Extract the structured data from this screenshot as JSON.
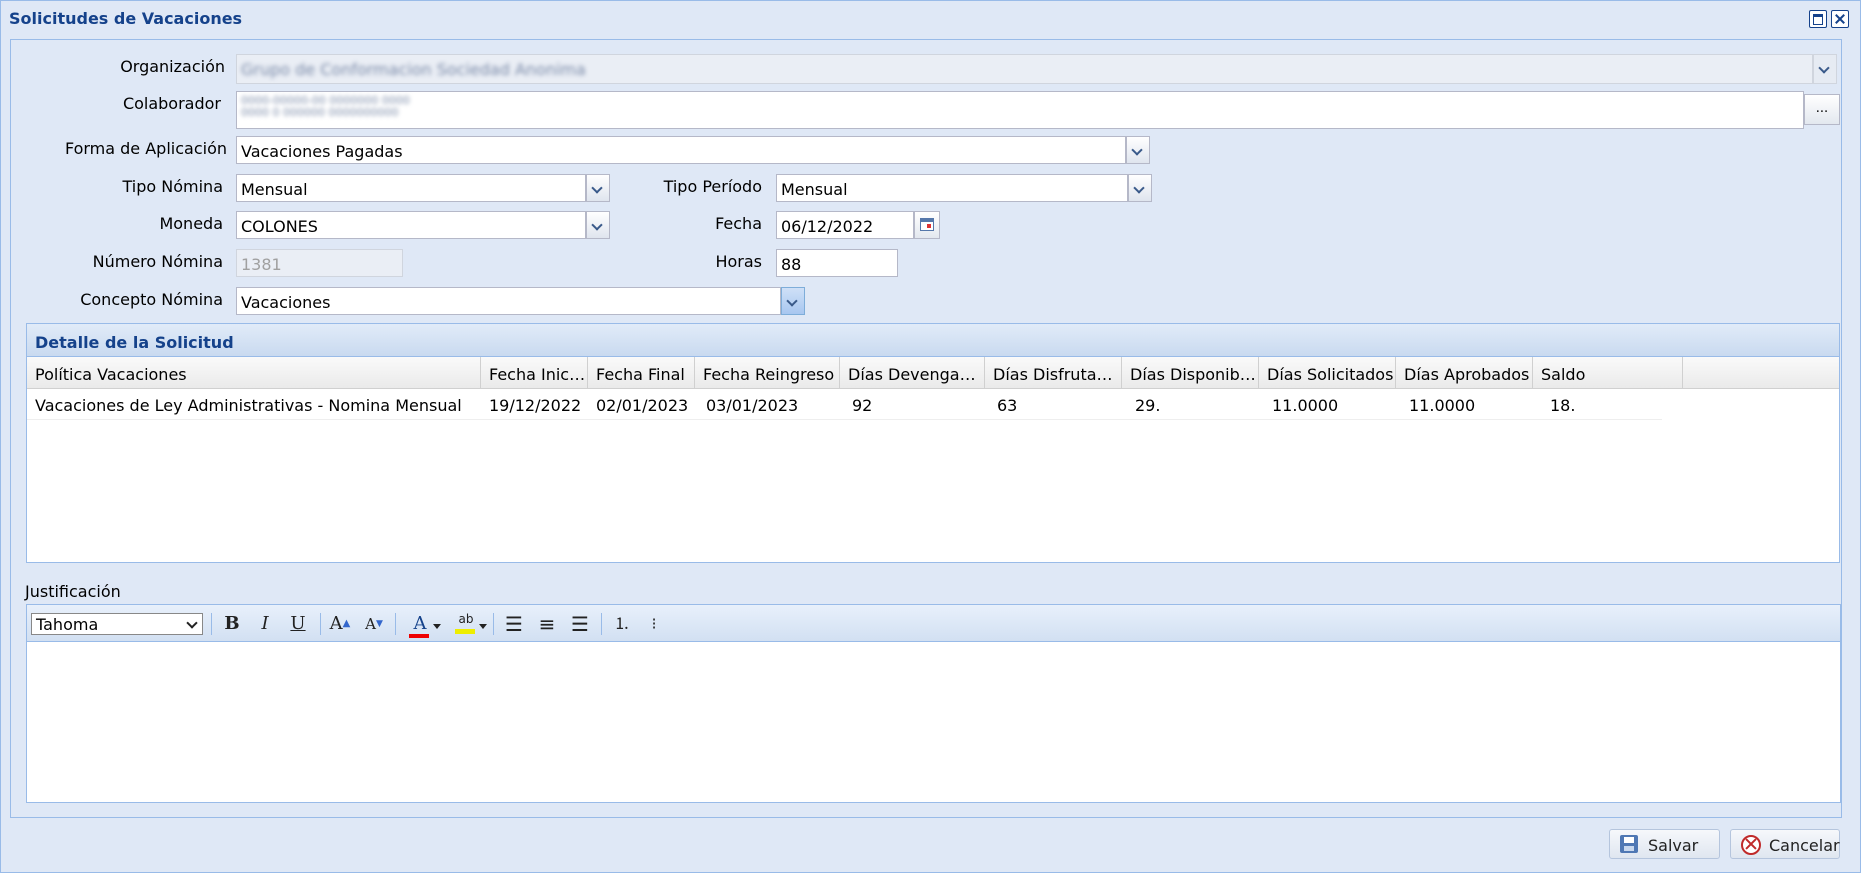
{
  "window": {
    "title": "Solicitudes de Vacaciones"
  },
  "form": {
    "organizacion": {
      "label": "Organización",
      "value": "Grupo de Conformacion Sociedad Anonima"
    },
    "colaborador": {
      "label": "Colaborador",
      "value_line1": "0000-00000-00 0000000 0000",
      "value_line2": "0000 0 000000 0000000000",
      "button": "..."
    },
    "forma_aplicacion": {
      "label": "Forma de Aplicación",
      "value": "Vacaciones Pagadas"
    },
    "tipo_nomina": {
      "label": "Tipo Nómina",
      "value": "Mensual"
    },
    "tipo_periodo": {
      "label": "Tipo Período",
      "value": "Mensual"
    },
    "moneda": {
      "label": "Moneda",
      "value": "COLONES"
    },
    "fecha": {
      "label": "Fecha",
      "value": "06/12/2022"
    },
    "numero_nomina": {
      "label": "Número Nómina",
      "value": "1381"
    },
    "horas": {
      "label": "Horas",
      "value": "88"
    },
    "concepto_nomina": {
      "label": "Concepto Nómina",
      "value": "Vacaciones"
    }
  },
  "detalle": {
    "title": "Detalle de la Solicitud",
    "columns": [
      "Política Vacaciones",
      "Fecha Inicial",
      "Fecha Final",
      "Fecha Reingreso",
      "Días Devengad...",
      "Días Disfrutados",
      "Días Disponibl...",
      "Días Solicitados",
      "Días Aprobados",
      "Saldo"
    ],
    "rows": [
      [
        "Vacaciones de Ley Administrativas - Nomina Mensual",
        "19/12/2022",
        "02/01/2023",
        "03/01/2023",
        "92",
        "63",
        "29.",
        "11.0000",
        "11.0000",
        "18."
      ]
    ]
  },
  "justificacion": {
    "label": "Justificación",
    "font": "Tahoma",
    "text": ""
  },
  "buttons": {
    "save": "Salvar",
    "cancel": "Cancelar"
  },
  "colors": {
    "title": "#15428b",
    "border": "#99bbe8",
    "background": "#dfe8f6"
  },
  "icons": [
    "maximize-icon",
    "close-icon",
    "calendar-icon",
    "bold-icon",
    "italic-icon",
    "underline-icon",
    "font-grow-icon",
    "font-shrink-icon",
    "font-color-icon",
    "highlight-icon",
    "align-left-icon",
    "align-center-icon",
    "align-right-icon",
    "ordered-list-icon",
    "bullet-list-icon",
    "save-icon",
    "cancel-icon"
  ]
}
